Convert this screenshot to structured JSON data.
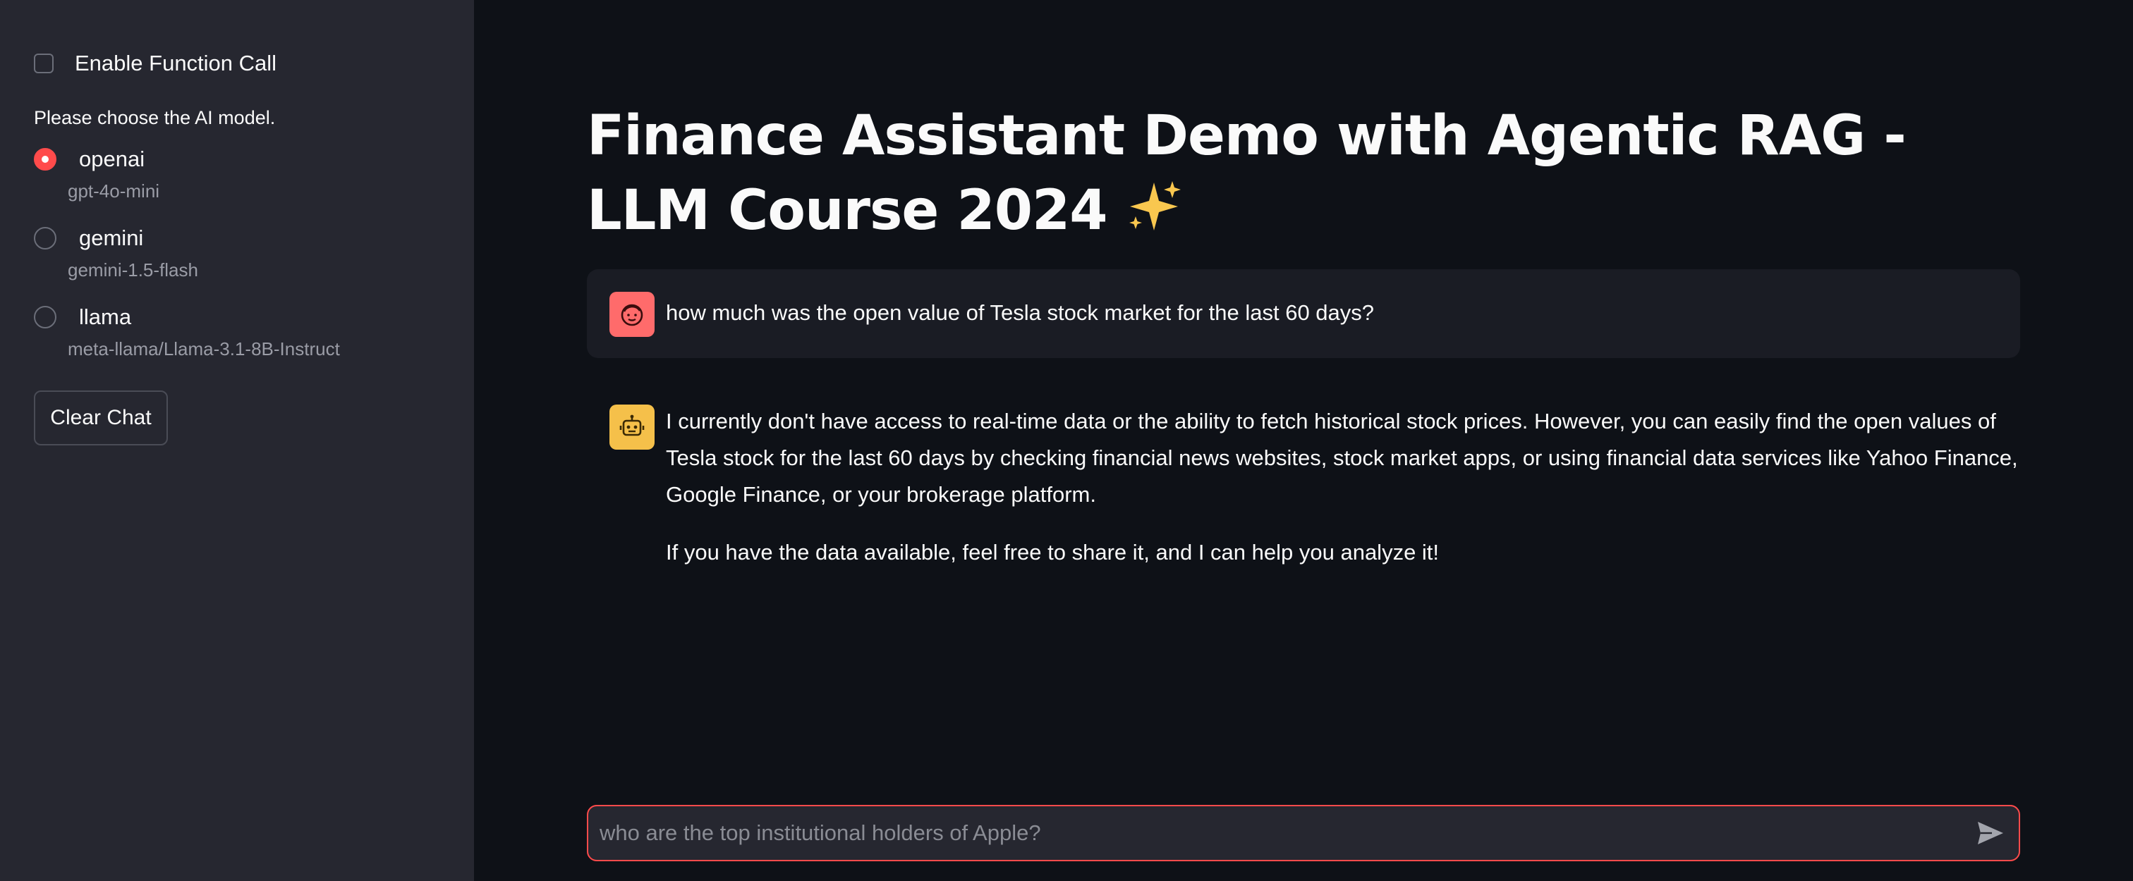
{
  "sidebar": {
    "function_call_label": "Enable Function Call",
    "function_call_checked": false,
    "model_prompt": "Please choose the AI model.",
    "models": [
      {
        "label": "openai",
        "caption": "gpt-4o-mini",
        "selected": true
      },
      {
        "label": "gemini",
        "caption": "gemini-1.5-flash",
        "selected": false
      },
      {
        "label": "llama",
        "caption": "meta-llama/Llama-3.1-8B-Instruct",
        "selected": false
      }
    ],
    "clear_chat_label": "Clear Chat"
  },
  "main": {
    "title": "Finance Assistant Demo with Agentic RAG - LLM Course 2024",
    "title_icon": "sparkles-icon",
    "messages": [
      {
        "role": "user",
        "avatar_icon": "user-face-icon",
        "paragraphs": [
          "how much was the open value of Tesla stock market for the last 60 days?"
        ]
      },
      {
        "role": "assistant",
        "avatar_icon": "robot-icon",
        "paragraphs": [
          "I currently don't have access to real-time data or the ability to fetch historical stock prices. However, you can easily find the open values of Tesla stock for the last 60 days by checking financial news websites, stock market apps, or using financial data services like Yahoo Finance, Google Finance, or your brokerage platform.",
          "If you have the data available, feel free to share it, and I can help you analyze it!"
        ]
      }
    ],
    "chat_input": {
      "value": "",
      "placeholder": "who are the top institutional holders of Apple?",
      "send_icon": "send-icon"
    }
  },
  "colors": {
    "sidebar_bg": "#262730",
    "main_bg": "#0e1117",
    "accent": "#ff4b4b",
    "user_avatar": "#ff6b6b",
    "bot_avatar": "#f5c04a",
    "user_bubble": "#1a1c24"
  }
}
